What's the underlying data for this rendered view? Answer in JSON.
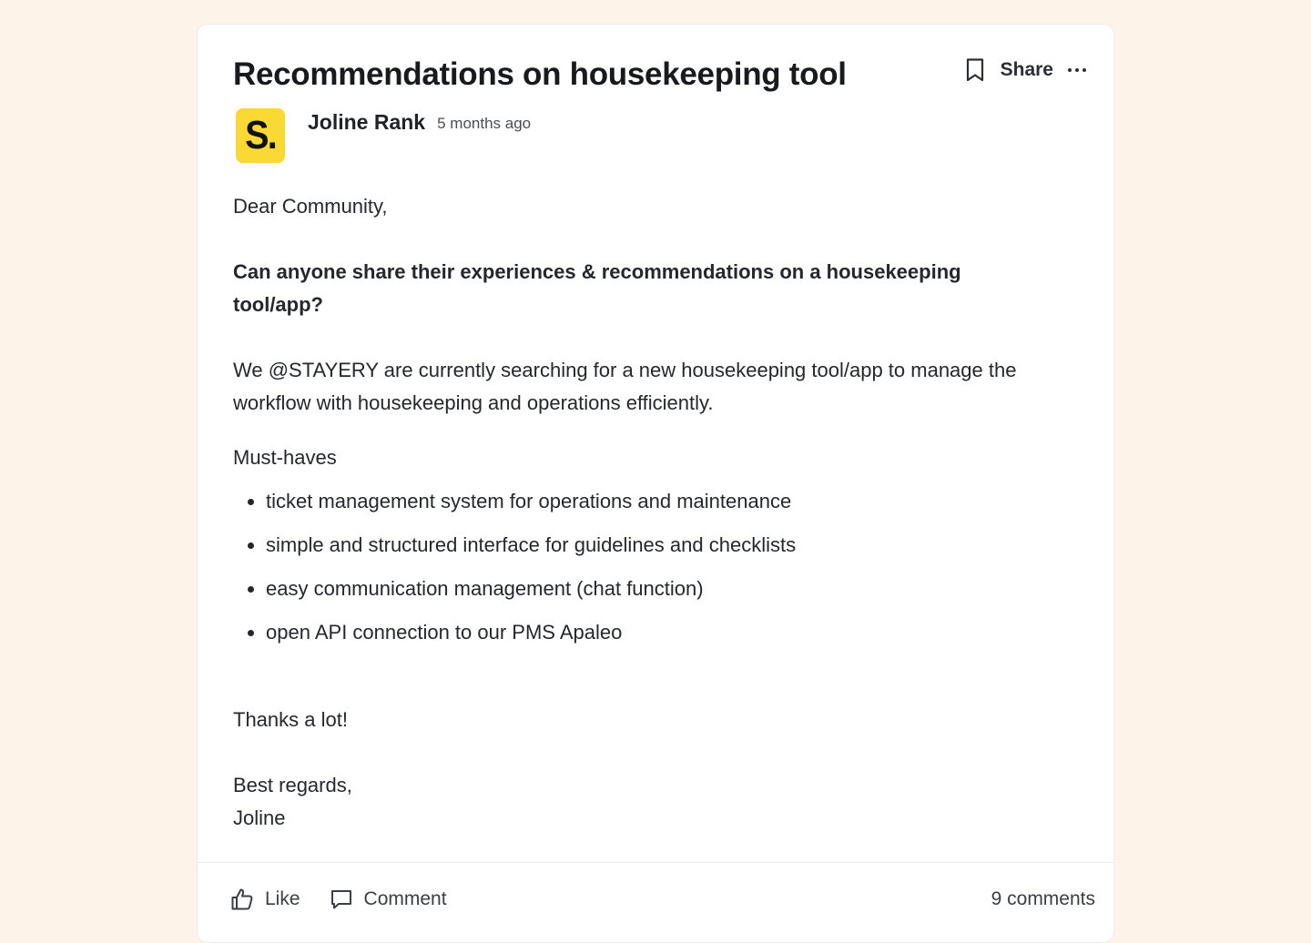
{
  "post": {
    "title": "Recommendations on housekeeping tool",
    "share_label": "Share",
    "author": {
      "avatar_text": "S.",
      "name": "Joline Rank",
      "time": "5 months ago"
    },
    "body": {
      "greeting": "Dear Community,",
      "question": "Can anyone share their experiences & recommendations on a housekeeping tool/app?",
      "description": "We @STAYERY are currently searching for a new housekeeping tool/app to manage the workflow with housekeeping and operations efficiently.",
      "must_haves_label": "Must-haves",
      "must_haves": [
        "ticket management system for operations and maintenance",
        "simple and structured interface for guidelines and checklists",
        "easy communication management (chat function)",
        "open API connection to our PMS Apaleo"
      ],
      "thanks": "Thanks a lot!",
      "regards": "Best regards,",
      "signature": "Joline"
    },
    "footer": {
      "like_label": "Like",
      "comment_label": "Comment",
      "comments_count": "9 comments"
    }
  },
  "colors": {
    "page_background": "#fdf3e9",
    "avatar_background": "#fbd935",
    "text": "#1f2328"
  },
  "icons": [
    "bookmark-icon",
    "more-icon",
    "thumbs-up-icon",
    "comment-icon"
  ]
}
